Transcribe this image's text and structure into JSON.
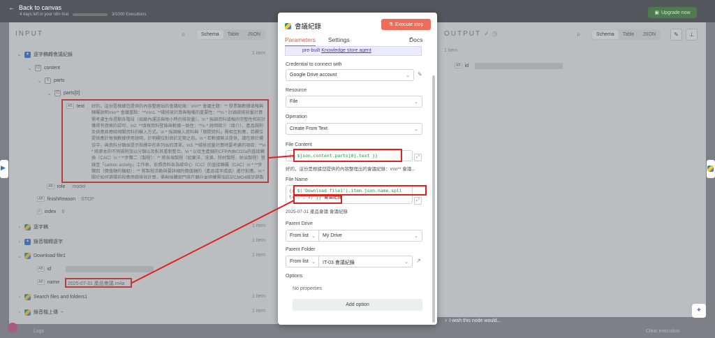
{
  "topbar": {
    "back_label": "Back to canvas",
    "trial_text": "4 days left in your n8n trial",
    "executions_text": "3/1000 Executions",
    "upgrade_label": "Upgrade now"
  },
  "input": {
    "title": "INPUT",
    "views": [
      "Schema",
      "Table",
      "JSON"
    ],
    "tree": {
      "node1": "逐字稿轉會議紀錄",
      "node1_items": "1 item",
      "content": "content",
      "parts": "parts",
      "parts0": "parts[0]",
      "text_key": "text",
      "text_value": "好的，這份是根據您提供的內容整理出的會議紀錄：\\n\\n** 會議主題：** 發票類數據填報與歸屬說明\\n\\n** 會議重點：**\\n\\n1. **碳排放計算與報備的重要性：**\\n * 討論碳排放量計算需考慮生命週期各階段（如廠內運送與每小時的排放量）。\\n * 強調資料填報的完整性和前於獲得有資格的認可。\\n2. **填報資料登錄與數據一致性：**\\n * 說明碳介（填介）、產品規則及供應商應碳相關資料的輸入方式。\\n * 強調輸入資料與「期間資料」需相互對應，若欄位提供應於每個數據使用說明，於明欄位對齊於定期之前。\\n * 若數據無法提供，請在原於欄位中，與資料分類並提示指標中的未列出的清單。\\n3. **碳排放量計算時要考慮的項目：**\\n * 將原本的不同規則加以分類以及對其重新整合。\\n * 以從生產線的CFP內由CO2a的直接轉換（CAC）\\n * **步驟二（製程）：** 將各項製程（如東洋、洗滌、除材製程、射出製程）登錄至「carbon activity」工作表，依照資料各為碳中心（CC）的直接歸屬（CAC）\\n * **步驟四（價值鏈的機組）：** 將製程活動與要詳細的價值鏈的（產品或半成品）進行對應。\\n * 關於如何選擇前段應用碳排放計算，需與採購部門來在歸戶並明確需加註記CMO4碳足跡製程，以及CMO2的出製程，填入相關的碳活動（CA01, CA02）。\\n * 強調模組資料的登錄需考量現在與未來的使用需求。...",
      "role_key": "role",
      "role_value": "model",
      "finish_key": "finishReason",
      "finish_value": "STOP",
      "index_key": "index",
      "index_value": "0",
      "node2": "逐字稿",
      "node3": "錄音檔轉逐字",
      "node4": "Download file1",
      "id_key": "id",
      "name_key": "name",
      "name_value": "2025-07-31 產品會議.m4a",
      "node5": "Search files and folders1",
      "node6": "錄音檔上傳",
      "node6_suffix": "+",
      "items_label": "1 item"
    }
  },
  "node": {
    "title": "會議紀錄",
    "execute_label": "Execute step",
    "tabs": [
      "Parameters",
      "Settings"
    ],
    "docs_label": "Docs",
    "notice_prefix": "pre-built",
    "notice_link": "Knowledge store agent",
    "credential_label": "Credential to connect with",
    "credential_value": "Google Drive account",
    "resource_label": "Resource",
    "resource_value": "File",
    "operation_label": "Operation",
    "operation_value": "Create From Text",
    "file_content_label": "File Content",
    "file_content_expr": "{{ $json.content.parts[0].text }}",
    "file_content_preview": "好的，這份是根據您提供的內容整理出的會議紀錄：\\n\\n** 會議...",
    "file_name_label": "File Name",
    "file_name_expr_1": "{{ $('Download file1').item.json.name.spli",
    "file_name_expr_2": "t('.', 1) }}",
    "file_name_expr_suffix": "會議紀錄",
    "file_name_preview": "2025-07-31 產品會議 會議紀錄",
    "parent_drive_label": "Parent Drive",
    "parent_drive_mode": "From list",
    "parent_drive_value": "My Drive",
    "parent_folder_label": "Parent Folder",
    "parent_folder_mode": "From list",
    "parent_folder_value": "IT-03 會議紀錄",
    "options_label": "Options",
    "no_properties": "No properties",
    "add_option_label": "Add option"
  },
  "output": {
    "title": "OUTPUT",
    "views": [
      "Schema",
      "Table",
      "JSON"
    ],
    "items": "1 item",
    "id_key": "id"
  },
  "footer": {
    "wish_label": "I wish this node would...",
    "logs_label": "Logs",
    "clear_label": "Clear execution"
  },
  "colors": {
    "accent": "#e05a4a",
    "execute": "#ef6b5a",
    "expression": "#1f9d55",
    "highlight_box": "#e12020"
  }
}
